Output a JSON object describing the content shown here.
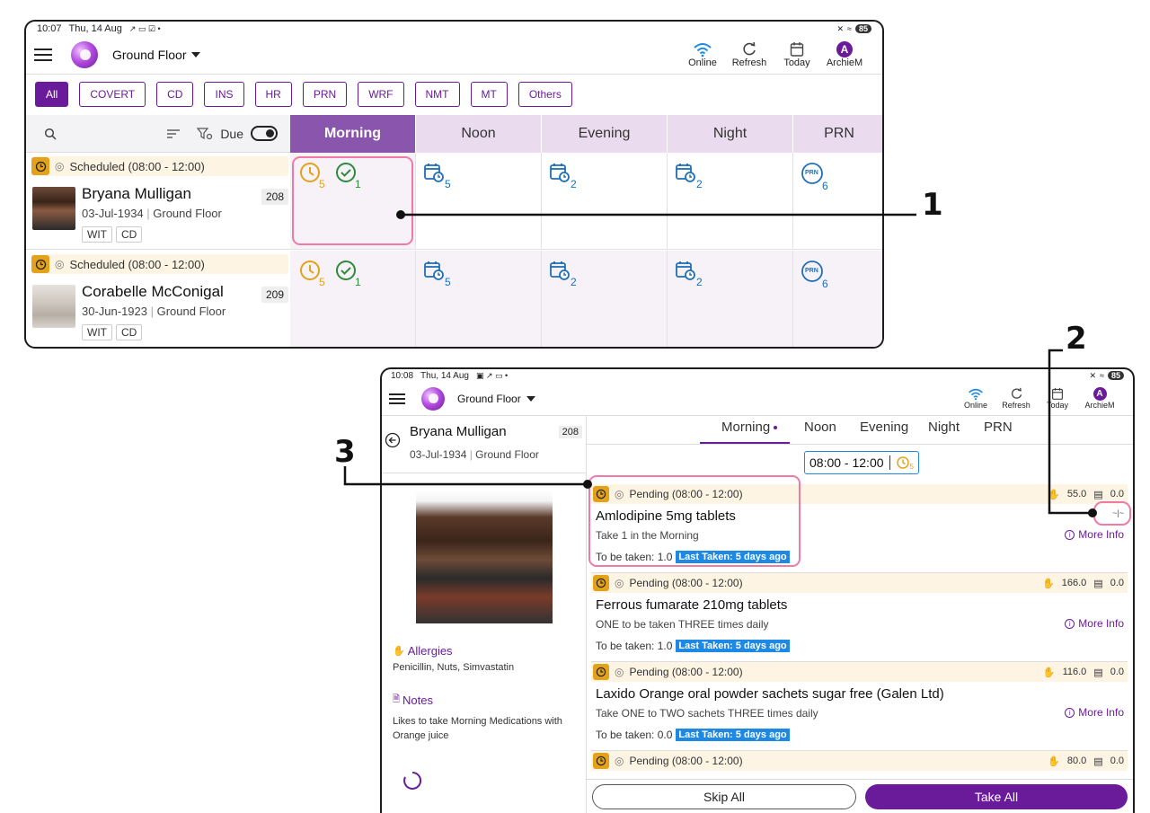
{
  "top": {
    "status": {
      "time": "10:07",
      "date": "Thu, 14 Aug",
      "battery": "85"
    },
    "floor": "Ground Floor",
    "actions": {
      "online": "Online",
      "refresh": "Refresh",
      "today": "Today",
      "user": "ArchieM",
      "avatar_letter": "A"
    },
    "filters": [
      "All",
      "COVERT",
      "CD",
      "INS",
      "HR",
      "PRN",
      "WRF",
      "NMT",
      "MT",
      "Others"
    ],
    "due_label": "Due",
    "tabs": [
      "Morning",
      "Noon",
      "Evening",
      "Night",
      "PRN"
    ],
    "patients": [
      {
        "schedule": "Scheduled (08:00 - 12:00)",
        "name": "Bryana Mulligan",
        "dob": "03-Jul-1934",
        "floor": "Ground Floor",
        "room": "208",
        "tags": [
          "WIT",
          "CD"
        ],
        "morning": {
          "pending": "5",
          "done": "1"
        },
        "noon": "5",
        "evening": "2",
        "night": "2",
        "prn": "6",
        "prn_icon": "PRN"
      },
      {
        "schedule": "Scheduled (08:00 - 12:00)",
        "name": "Corabelle McConigal",
        "dob": "30-Jun-1923",
        "floor": "Ground Floor",
        "room": "209",
        "tags": [
          "WIT",
          "CD"
        ],
        "morning": {
          "pending": "5",
          "done": "1"
        },
        "noon": "5",
        "evening": "2",
        "night": "2",
        "prn": "6",
        "prn_icon": "PRN"
      }
    ]
  },
  "detail": {
    "status": {
      "time": "10:08",
      "date": "Thu, 14 Aug",
      "battery": "85"
    },
    "floor": "Ground Floor",
    "actions": {
      "online": "Online",
      "refresh": "Refresh",
      "today": "Today",
      "user": "ArchieM",
      "avatar_letter": "A"
    },
    "patient": {
      "name": "Bryana Mulligan",
      "room": "208",
      "dob": "03-Jul-1934",
      "floor": "Ground Floor"
    },
    "allergies_label": "Allergies",
    "allergies": "Penicillin, Nuts, Simvastatin",
    "notes_label": "Notes",
    "notes": "Likes to take Morning Medications with Orange juice",
    "tabs": [
      "Morning",
      "Noon",
      "Evening",
      "Night",
      "PRN"
    ],
    "time_range": "08:00 - 12:00",
    "time_count": "5",
    "meds": [
      {
        "status": "Pending (08:00 - 12:00)",
        "stock_a": "55.0",
        "stock_b": "0.0",
        "name": "Amlodipine 5mg tablets",
        "instr": "Take 1 in the Morning",
        "to_be_taken": "To be taken: 1.0",
        "last_taken": "Last Taken: 5 days ago",
        "more": "More Info"
      },
      {
        "status": "Pending (08:00 - 12:00)",
        "stock_a": "166.0",
        "stock_b": "0.0",
        "name": "Ferrous fumarate 210mg tablets",
        "instr": "ONE to be taken THREE times daily",
        "to_be_taken": "To be taken: 1.0",
        "last_taken": "Last Taken: 5 days ago",
        "more": "More Info"
      },
      {
        "status": "Pending (08:00 - 12:00)",
        "stock_a": "116.0",
        "stock_b": "0.0",
        "name": "Laxido Orange oral powder sachets sugar free (Galen Ltd)",
        "instr": "Take ONE to TWO sachets THREE times daily",
        "to_be_taken": "To be taken: 0.0",
        "last_taken": "Last Taken: 5 days ago",
        "more": "More Info"
      },
      {
        "status": "Pending (08:00 - 12:00)",
        "stock_a": "80.0",
        "stock_b": "0.0"
      }
    ],
    "skip_all": "Skip All",
    "take_all": "Take All"
  },
  "callouts": [
    "1",
    "2",
    "3"
  ],
  "colors": {
    "brand": "#6a1b9a",
    "active_tab": "#8a56ad",
    "pending": "#e3a21a",
    "done": "#2e8b3a",
    "link": "#1e88e5",
    "annotation": "#f07aa6"
  }
}
